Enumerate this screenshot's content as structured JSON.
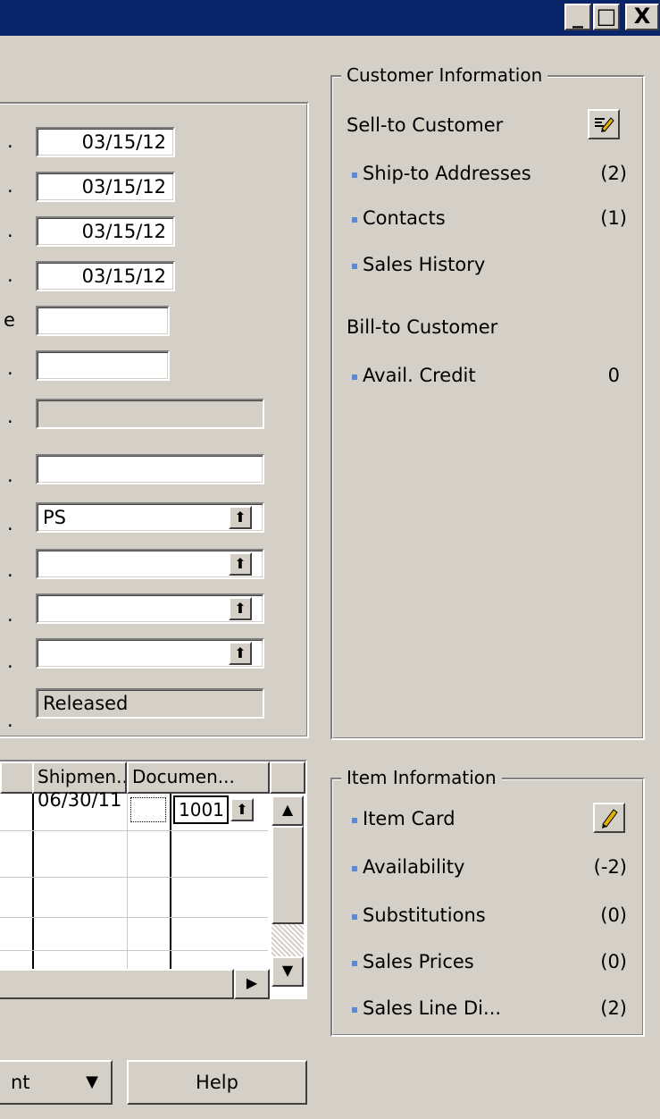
{
  "window": {
    "minimize_glyph": "_",
    "maximize_glyph": "□",
    "close_glyph": "X"
  },
  "form": {
    "dates": [
      "03/15/12",
      "03/15/12",
      "03/15/12",
      "03/15/12"
    ],
    "partial_label_char": "e",
    "dot": ".",
    "lookup_value": "PS",
    "status_value": "Released"
  },
  "customer_info": {
    "title": "Customer Information",
    "sell_to": "Sell-to Customer",
    "ship_to": "Ship-to Addresses",
    "ship_to_count": "(2)",
    "contacts": "Contacts",
    "contacts_count": "(1)",
    "sales_history": "Sales History",
    "bill_to": "Bill-to Customer",
    "avail_credit": "Avail. Credit",
    "avail_credit_value": "0"
  },
  "grid": {
    "columns": [
      "Shipmen...",
      "Documen..."
    ],
    "row1_shipment": "06/30/11",
    "row1_document": "1001"
  },
  "item_info": {
    "title": "Item Information",
    "item_card": "Item Card",
    "availability": "Availability",
    "availability_count": "(-2)",
    "substitutions": "Substitutions",
    "substitutions_count": "(0)",
    "sales_prices": "Sales Prices",
    "sales_prices_count": "(0)",
    "sales_line_disc": "Sales Line Di...",
    "sales_line_disc_count": "(2)"
  },
  "buttons": {
    "print_partial": "nt",
    "help": "Help"
  },
  "colors": {
    "title_bar": "#0a246a",
    "face": "#d4d0c8",
    "bullet": "#5a8ad6"
  }
}
